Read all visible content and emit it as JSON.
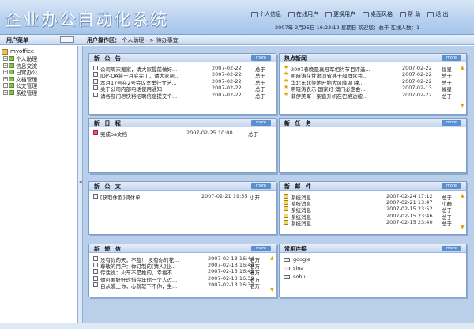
{
  "app_title": "企业办公自动化系统",
  "topnav": [
    {
      "label": "个人信息",
      "icon": "person-icon"
    },
    {
      "label": "在线用户",
      "icon": "users-icon"
    },
    {
      "label": "更换用户",
      "icon": "switch-user-icon"
    },
    {
      "label": "桌面风格",
      "icon": "desktop-icon"
    },
    {
      "label": "帮  助",
      "icon": "help-icon"
    },
    {
      "label": "退  出",
      "icon": "exit-icon"
    }
  ],
  "status_line": "2007年 2月25日  16:23:12  星期日    欢迎您：总于      在线人数：1",
  "user_menu_label": "用户菜单",
  "breadcrumb_prefix": "用户操作区：",
  "breadcrumb_path": "个人助理  -->  待办事宜",
  "sidebar": {
    "root": "myoffice",
    "items": [
      "个人助理",
      "信息交流",
      "日常办公",
      "文档管理",
      "公文管理",
      "系统管理"
    ]
  },
  "panels": {
    "notice": {
      "title": "新 公 告",
      "more": "more",
      "rows": [
        {
          "text": "公司周末搬家，请大家提前做好...",
          "date": "2007-02-22",
          "user": "总于"
        },
        {
          "text": "IDP-OA将于月底完工，请大家帮...",
          "date": "2007-02-22",
          "user": "总于"
        },
        {
          "text": "本月17号在2号会议室举行文艺...",
          "date": "2007-02-22",
          "user": "总于"
        },
        {
          "text": "关于公司内部电话使用通知",
          "date": "2007-02-22",
          "user": "总于"
        },
        {
          "text": "请各部门尽快将招聘信息提交个...",
          "date": "2007-02-22",
          "user": "总于"
        }
      ]
    },
    "news": {
      "title": "热点新闻",
      "more": "more",
      "rows": [
        {
          "text": "2007春晚是真冠军相约节目评选...",
          "date": "2007-02-22",
          "user": "福星"
        },
        {
          "text": "明晓涛在甘肃同省甚干部群众共...",
          "date": "2007-02-22",
          "user": "总于"
        },
        {
          "text": "华北东北等地开始大风降温 陕...",
          "date": "2007-02-22",
          "user": "总于"
        },
        {
          "text": "明晓涛表示 国家好 澳门必定会...",
          "date": "2007-02-13",
          "user": "福星"
        },
        {
          "text": "菲伊美军一架直升机在巴格达被...",
          "date": "2007-02-22",
          "user": "总于"
        }
      ]
    },
    "schedule": {
      "title": "新 日 程",
      "more": "more",
      "rows": [
        {
          "text": "完成oa文档",
          "date": "2007-02-25 10:00",
          "user": "总于"
        }
      ]
    },
    "task": {
      "title": "新 任 务",
      "more": "more",
      "rows": []
    },
    "doc": {
      "title": "新 公 文",
      "more": "more",
      "rows": [
        {
          "text": "[获取休假]调休单",
          "date": "2007-02-21 19:55",
          "user": "小开"
        }
      ]
    },
    "mail": {
      "title": "新 邮 件",
      "more": "more",
      "rows": [
        {
          "text": "系统消息",
          "date": "2007-02-24 17:12",
          "user": "总于"
        },
        {
          "text": "系统消息",
          "date": "2007-02-21 13:47",
          "user": "小静"
        },
        {
          "text": "系统消息",
          "date": "2007-02-15 23:52",
          "user": "总于"
        },
        {
          "text": "系统消息",
          "date": "2007-02-15 23:46",
          "user": "总于"
        },
        {
          "text": "系统消息",
          "date": "2007-02-15 23:40",
          "user": "总于"
        }
      ]
    },
    "sms": {
      "title": "新 短 信",
      "more": "more",
      "rows": [
        {
          "text": "没有你的天，不蓝！ 没有你的花...",
          "date": "2007-02-13 16:44",
          "user": "老万"
        },
        {
          "text": "尊敬的用户：你订制的[猜人]业...",
          "date": "2007-02-13 16:44",
          "user": "老万"
        },
        {
          "text": "传话说：火车不是推的，幸福不...",
          "date": "2007-02-13 16:42",
          "user": "老万"
        },
        {
          "text": "你可要好好珍惜今年你一个人过...",
          "date": "2007-02-13 16:39",
          "user": "老万"
        },
        {
          "text": "自从爱上你，心就软下不你，生...",
          "date": "2007-02-13 16:37",
          "user": "老万"
        }
      ]
    },
    "links": {
      "title": "常用连接",
      "more": "more",
      "rows": [
        "google",
        "sina",
        "sohu"
      ]
    }
  }
}
